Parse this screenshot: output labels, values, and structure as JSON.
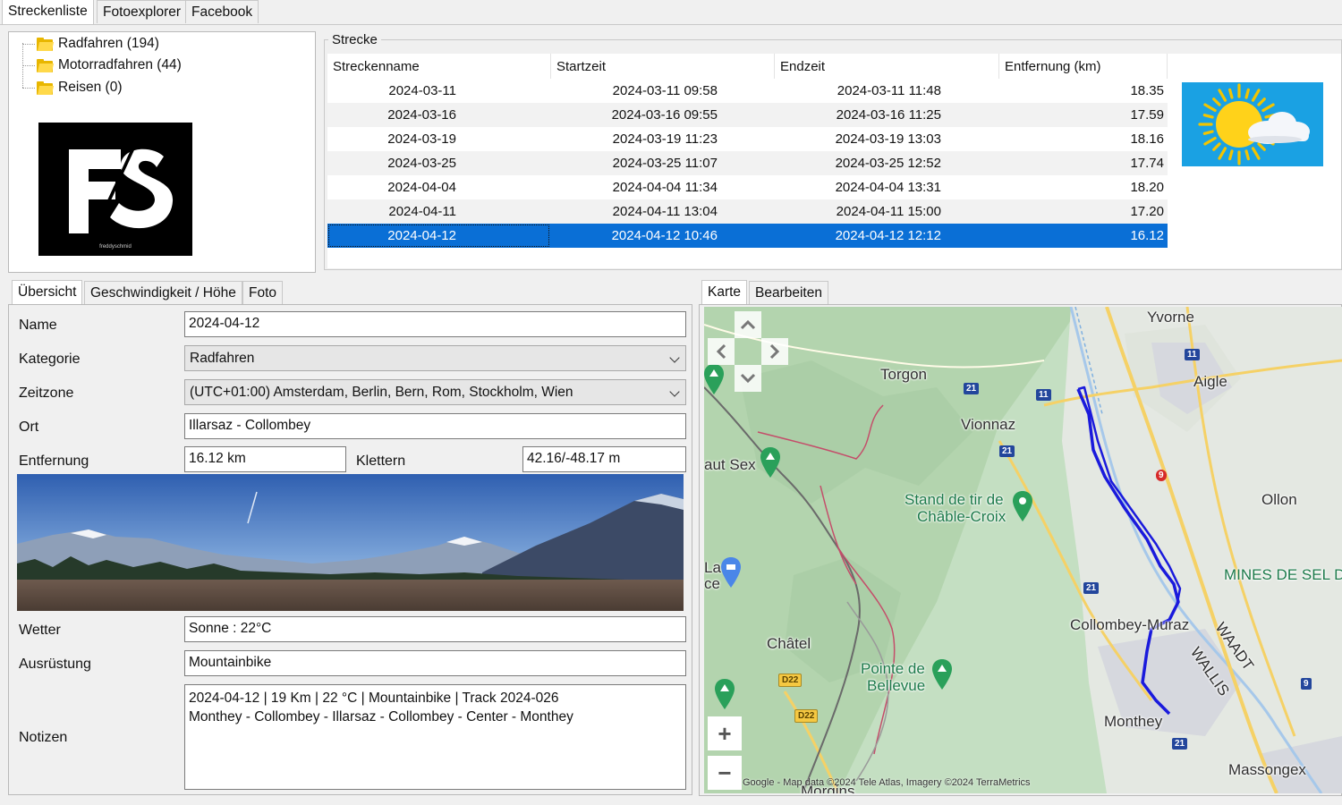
{
  "top_tabs": [
    "Streckenliste",
    "Fotoexplorer",
    "Facebook"
  ],
  "tree": {
    "items": [
      {
        "label": "Radfahren (194)"
      },
      {
        "label": "Motorradfahren (44)"
      },
      {
        "label": "Reisen (0)"
      }
    ]
  },
  "logo": {
    "text": "FS",
    "caption": "freddyschmid"
  },
  "strecke": {
    "group_title": "Strecke",
    "columns": [
      "Streckenname",
      "Startzeit",
      "Endzeit",
      "Entfernung (km)"
    ],
    "rows": [
      [
        "2024-03-11",
        "2024-03-11 09:58",
        "2024-03-11 11:48",
        "18.35"
      ],
      [
        "2024-03-16",
        "2024-03-16 09:55",
        "2024-03-16 11:25",
        "17.59"
      ],
      [
        "2024-03-19",
        "2024-03-19 11:23",
        "2024-03-19 13:03",
        "18.16"
      ],
      [
        "2024-03-25",
        "2024-03-25 11:07",
        "2024-03-25 12:52",
        "17.74"
      ],
      [
        "2024-04-04",
        "2024-04-04 11:34",
        "2024-04-04 13:31",
        "18.20"
      ],
      [
        "2024-04-11",
        "2024-04-11 13:04",
        "2024-04-11 15:00",
        "17.20"
      ],
      [
        "2024-04-12",
        "2024-04-12 10:46",
        "2024-04-12 12:12",
        "16.12"
      ]
    ],
    "selected_row": 6
  },
  "detail_tabs": [
    "Übersicht",
    "Geschwindigkeit / Höhe",
    "Foto"
  ],
  "form": {
    "name_label": "Name",
    "name_value": "2024-04-12",
    "kategorie_label": "Kategorie",
    "kategorie_value": "Radfahren",
    "zeitzone_label": "Zeitzone",
    "zeitzone_value": "(UTC+01:00) Amsterdam, Berlin, Bern, Rom, Stockholm, Wien",
    "ort_label": "Ort",
    "ort_value": "Illarsaz - Collombey",
    "entfernung_label": "Entfernung",
    "entfernung_value": "16.12 km",
    "klettern_label": "Klettern",
    "klettern_value": "42.16/-48.17 m",
    "wetter_label": "Wetter",
    "wetter_value": "Sonne  :  22°C",
    "ausruestung_label": "Ausrüstung",
    "ausruestung_value": "Mountainbike",
    "notizen_label": "Notizen",
    "notizen_line1": "2024-04-12  |  19 Km  |  22 °C  |  Mountainbike  |  Track 2024-026",
    "notizen_line2": "Monthey - Collombey - Illarsaz - Collombey - Center - Monthey"
  },
  "map_tabs": [
    "Karte",
    "Bearbeiten"
  ],
  "map": {
    "places": [
      "Yvorne",
      "Aigle",
      "Torgon",
      "Vionnaz",
      "aut Sex",
      "Stand de tir de",
      "Châble-Croix",
      "Ollon",
      "MINES DE SEL DI",
      "Collombey-Muraz",
      "WAADT",
      "WALLIS",
      "Châtel",
      "Pointe de",
      "Bellevue",
      "Monthey",
      "Massongex",
      "Morgins",
      "La",
      "ce"
    ],
    "road_numbers": [
      "11",
      "21",
      "21",
      "11",
      "9",
      "21",
      "D22",
      "D22",
      "9",
      "21"
    ],
    "zoom_in": "+",
    "zoom_out": "−",
    "attribution": "Google - Map data ©2024 Tele Atlas, Imagery ©2024 TerraMetrics"
  },
  "colors": {
    "selection": "#0a6fd6",
    "track": "#1a1adc",
    "weather_bg": "#1aa1e3",
    "map_bg": "#bfe0bf"
  },
  "icons": [
    "folder-icon",
    "weather-sun-cloud-icon",
    "chevron-down-icon",
    "map-pin-icon",
    "pan-arrow-icon"
  ]
}
